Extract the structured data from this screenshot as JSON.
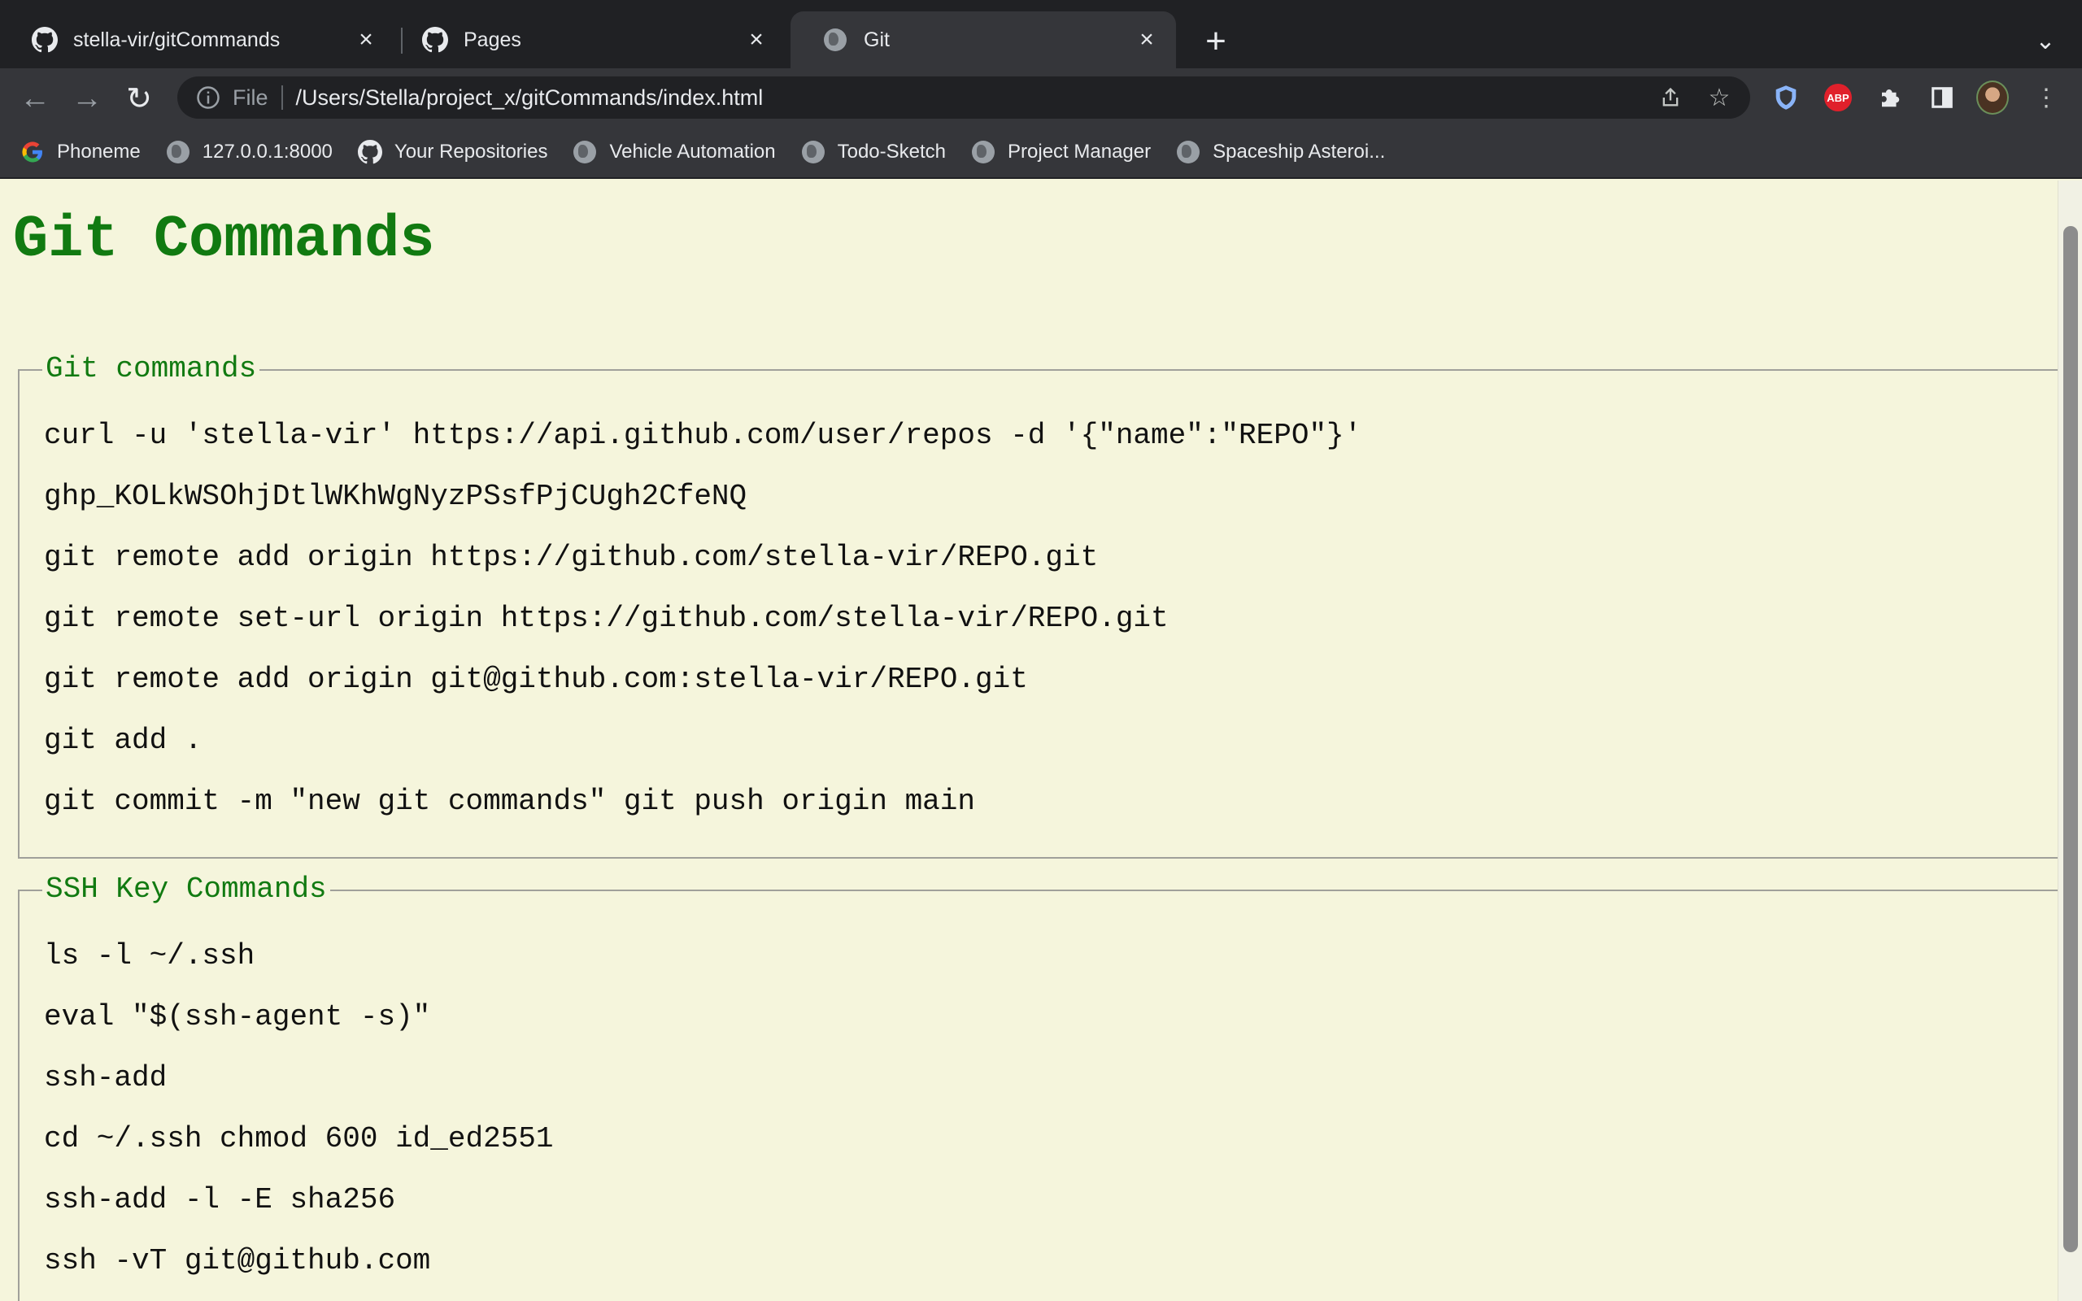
{
  "browser": {
    "tabs": [
      {
        "title": "stella-vir/gitCommands",
        "icon": "github-icon"
      },
      {
        "title": "Pages",
        "icon": "github-icon"
      },
      {
        "title": "Git",
        "icon": "globe-icon"
      }
    ],
    "address": {
      "scheme": "File",
      "url": "/Users/Stella/project_x/gitCommands/index.html"
    },
    "bookmarks": [
      {
        "label": "Phoneme",
        "icon": "google-icon"
      },
      {
        "label": "127.0.0.1:8000",
        "icon": "globe-icon"
      },
      {
        "label": "Your Repositories",
        "icon": "github-icon"
      },
      {
        "label": "Vehicle Automation",
        "icon": "globe-icon"
      },
      {
        "label": "Todo-Sketch",
        "icon": "globe-icon"
      },
      {
        "label": "Project Manager",
        "icon": "globe-icon"
      },
      {
        "label": "Spaceship Asteroi...",
        "icon": "globe-icon"
      }
    ],
    "extensions": {
      "abp_label": "ABP"
    }
  },
  "page": {
    "title": "Git Commands",
    "sections": [
      {
        "legend": "Git commands",
        "commands": [
          "curl -u 'stella-vir' https://api.github.com/user/repos -d '{\"name\":\"REPO\"}'",
          "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",
          "git remote add origin https://github.com/stella-vir/REPO.git",
          "git remote set-url origin https://github.com/stella-vir/REPO.git",
          "git remote add origin git@github.com:stella-vir/REPO.git",
          "git add .",
          "git commit -m \"new git commands\" git push origin main"
        ]
      },
      {
        "legend": "SSH Key Commands",
        "commands": [
          "ls -l ~/.ssh",
          "eval \"$(ssh-agent -s)\"",
          "ssh-add",
          "cd ~/.ssh chmod 600 id_ed2551",
          "ssh-add -l -E sha256",
          "ssh -vT git@github.com"
        ]
      }
    ]
  },
  "colors": {
    "page_bg": "#f5f5dc",
    "heading": "#117a11",
    "chrome_dark": "#202124",
    "chrome": "#35363a"
  }
}
